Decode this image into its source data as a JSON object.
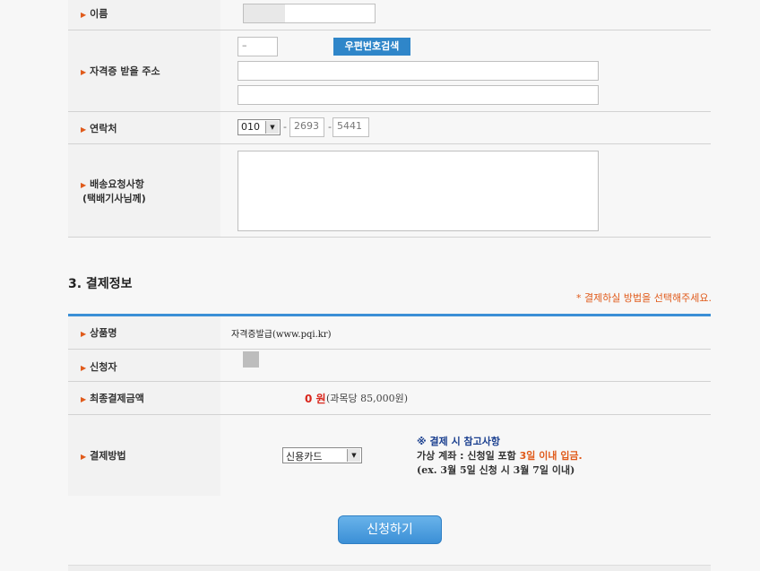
{
  "form": {
    "name_label": "이름",
    "address_label": "자격증 받을 주소",
    "zip_dash": "–",
    "zip_button": "우편번호검색",
    "phone_label": "연락처",
    "phone_prefix": "010",
    "phone_sep1": "-",
    "phone_mid": "2693",
    "phone_sep2": "-",
    "phone_last": "5441",
    "delivery_label_1": "배송요청사항",
    "delivery_label_2": "(택배기사님께)"
  },
  "payment": {
    "section_title": "3. 결제정보",
    "notice": "* 결제하실 방법을 선택해주세요.",
    "product_label": "상품명",
    "product_value": "자격증발급(www.pqi.kr)",
    "applicant_label": "신청자",
    "total_label": "최종결제금액",
    "amount": "0 원",
    "amount_note": "(과목당 85,000원)",
    "method_label": "결제방법",
    "method_value": "신용카드",
    "ref_title": "※ 결제 시 참고사항",
    "ref_line1_a": "가상 계좌 : 신청일 포함 ",
    "ref_line1_b": "3일 이내 입금.",
    "ref_line2": "(ex. 3월 5일 신청 시 3월 7일 이내)",
    "submit": "신청하기"
  },
  "colors": {
    "accent_blue": "#3b8fd6",
    "orange": "#e05a1a",
    "red": "#d9261c",
    "navy": "#1a3f8f"
  }
}
